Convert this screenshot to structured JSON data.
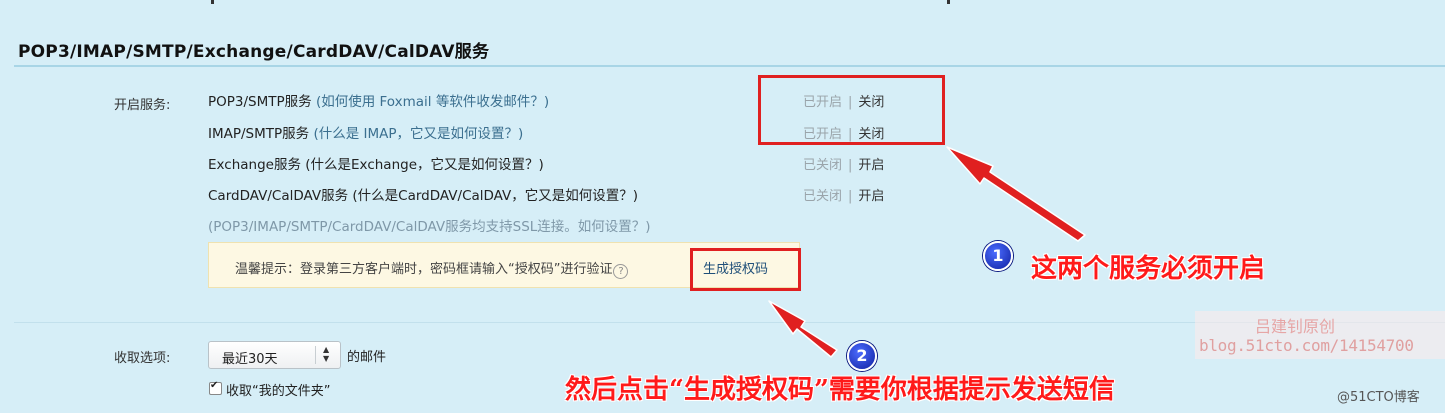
{
  "section": {
    "title": "POP3/IMAP/SMTP/Exchange/CardDAV/CalDAV服务"
  },
  "services": {
    "label": "开启服务:",
    "items": [
      {
        "name": "POP3/SMTP服务",
        "help": "(如何使用 Foxmail 等软件收发邮件？)",
        "state": "已开启",
        "sep": "|",
        "action": "关闭"
      },
      {
        "name": "IMAP/SMTP服务",
        "help": "(什么是 IMAP，它又是如何设置？)",
        "state": "已开启",
        "sep": "|",
        "action": "关闭"
      },
      {
        "name": "Exchange服务",
        "help": "(什么是Exchange，它又是如何设置？)",
        "state": "已关闭",
        "sep": "|",
        "action": "开启"
      },
      {
        "name": "CardDAV/CalDAV服务",
        "help": "(什么是CardDAV/CalDAV，它又是如何设置？)",
        "state": "已关闭",
        "sep": "|",
        "action": "开启"
      }
    ],
    "ssl_note": "(POP3/IMAP/SMTP/CardDAV/CalDAV服务均支持SSL连接。如何设置？)"
  },
  "tip": {
    "text": "温馨提示：登录第三方客户端时，密码框请输入“授权码”进行验证",
    "help_icon": "question-circle-icon",
    "link": "生成授权码"
  },
  "receive": {
    "label": "收取选项:",
    "select_value": "最近30天",
    "suffix": "的邮件",
    "checkbox_label": "收取“我的文件夹”",
    "checkbox_checked": true
  },
  "annotations": {
    "badge1": "1",
    "text1": "这两个服务必须开启",
    "badge2": "2",
    "text2": "然后点击“生成授权码”需要你根据提示发送短信",
    "color": "#e02020"
  },
  "watermark": {
    "name": "吕建钊原创",
    "url": "blog.51cto.com/14154700"
  },
  "corner_mark": "@51CTO博客"
}
